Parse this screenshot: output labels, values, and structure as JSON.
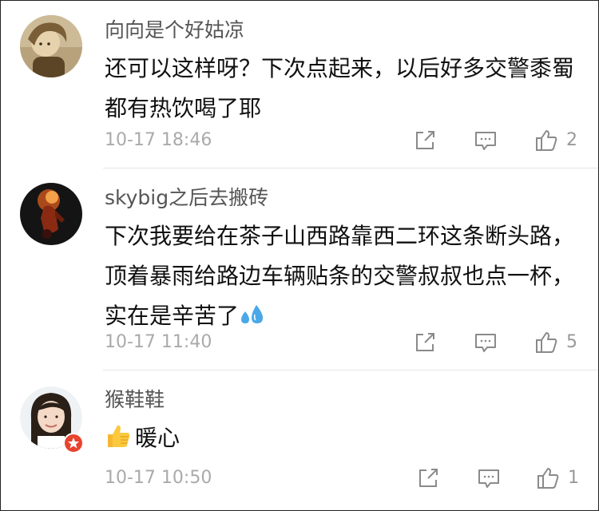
{
  "comments": [
    {
      "username": "向向是个好姑凉",
      "text": "还可以这样呀？下次点起来，以后好多交警黍蜀都有热饮喝了耶",
      "time": "10-17 18:46",
      "likes": "2",
      "avatar_icon": "user-photo-girl-sepia"
    },
    {
      "username": "skybig之后去搬砖",
      "text": "下次我要给在茶子山西路靠西二环这条断头路，顶着暴雨给路边车辆贴条的交警叔叔也点一杯，实在是辛苦了",
      "time": "10-17 11:40",
      "likes": "5",
      "avatar_icon": "user-photo-dark-figure"
    },
    {
      "username": "猴鞋鞋",
      "text": "暖心",
      "time": "10-17 10:50",
      "likes": "1",
      "avatar_icon": "user-photo-woman",
      "leading_emoji": "thumbs-up-emoji"
    }
  ],
  "icon_color": "#8a8a8a"
}
